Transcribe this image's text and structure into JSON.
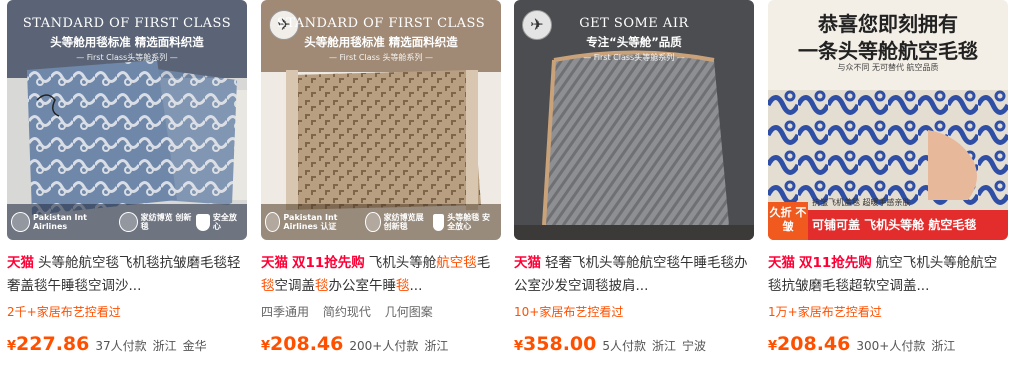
{
  "products": [
    {
      "image": {
        "en": "STANDARD OF FIRST CLASS",
        "cn": "头等舱用毯标准 精选面料织造",
        "sub": "— First Class头等舱系列 —",
        "badges": [
          "Pakistan Int Airlines",
          "家纺博览 创新毯",
          "安全放心"
        ]
      },
      "shop": "天猫",
      "title": "头等舱航空毯飞机毯抗皱磨毛毯轻奢盖毯午睡毯空调沙...",
      "sub": "2千+家居布艺控看过",
      "price": "227.86",
      "sales": "37人付款",
      "loc1": "浙江",
      "loc2": "金华"
    },
    {
      "image": {
        "en": "STANDARD OF FIRST CLASS",
        "cn": "头等舱用毯标准 精选面料织造",
        "sub": "— First Class 头等舱系列 —",
        "badges": [
          "Pakistan Int Airlines 认证",
          "家纺博览展 创新毯",
          "头等舱毯 安全放心"
        ]
      },
      "shop": "天猫",
      "promo": "双11抢先购",
      "title_a": "飞机头等舱",
      "title_b": "航空",
      "title_c": "毯",
      "title_d": "毛",
      "title_e": "毯",
      "title_f": "空调盖",
      "title_g": "毯",
      "title_h": "办公室午睡",
      "title_i": "毯",
      "title_j": "...",
      "tags": [
        "四季通用",
        "简约现代",
        "几何图案"
      ],
      "price": "208.46",
      "sales": "200+人付款",
      "loc1": "浙江"
    },
    {
      "image": {
        "en": "GET SOME AIR",
        "cn": "专注“头等舱”品质",
        "sub": "— First Class头等舱系列 —"
      },
      "shop": "天猫",
      "title": "轻奢飞机头等舱航空毯午睡毛毯办公室沙发空调毯披肩...",
      "sub": "10+家居布艺控看过",
      "price": "358.00",
      "sales": "5人付款",
      "loc1": "浙江",
      "loc2": "宁波"
    },
    {
      "image": {
        "line1": "恭喜您即刻拥有",
        "line2": "一条头等舱航空毛毯",
        "line3": "与众不同  无可替代  航空品质",
        "tag_zhe": "久折 不皱",
        "tag_small": "抗皱飞机盖毯  超暖手感亲肤",
        "bar": "可铺可盖  飞机头等舱  航空毛毯"
      },
      "shop": "天猫",
      "promo": "双11抢先购",
      "title": "航空飞机头等舱航空毯抗皱磨毛毯超软空调盖...",
      "sub": "1万+家居布艺控看过",
      "price": "208.46",
      "sales": "300+人付款",
      "loc1": "浙江"
    }
  ],
  "currency": "¥",
  "colors": {
    "accent": "#ff5000",
    "tmall": "#ff0036"
  }
}
